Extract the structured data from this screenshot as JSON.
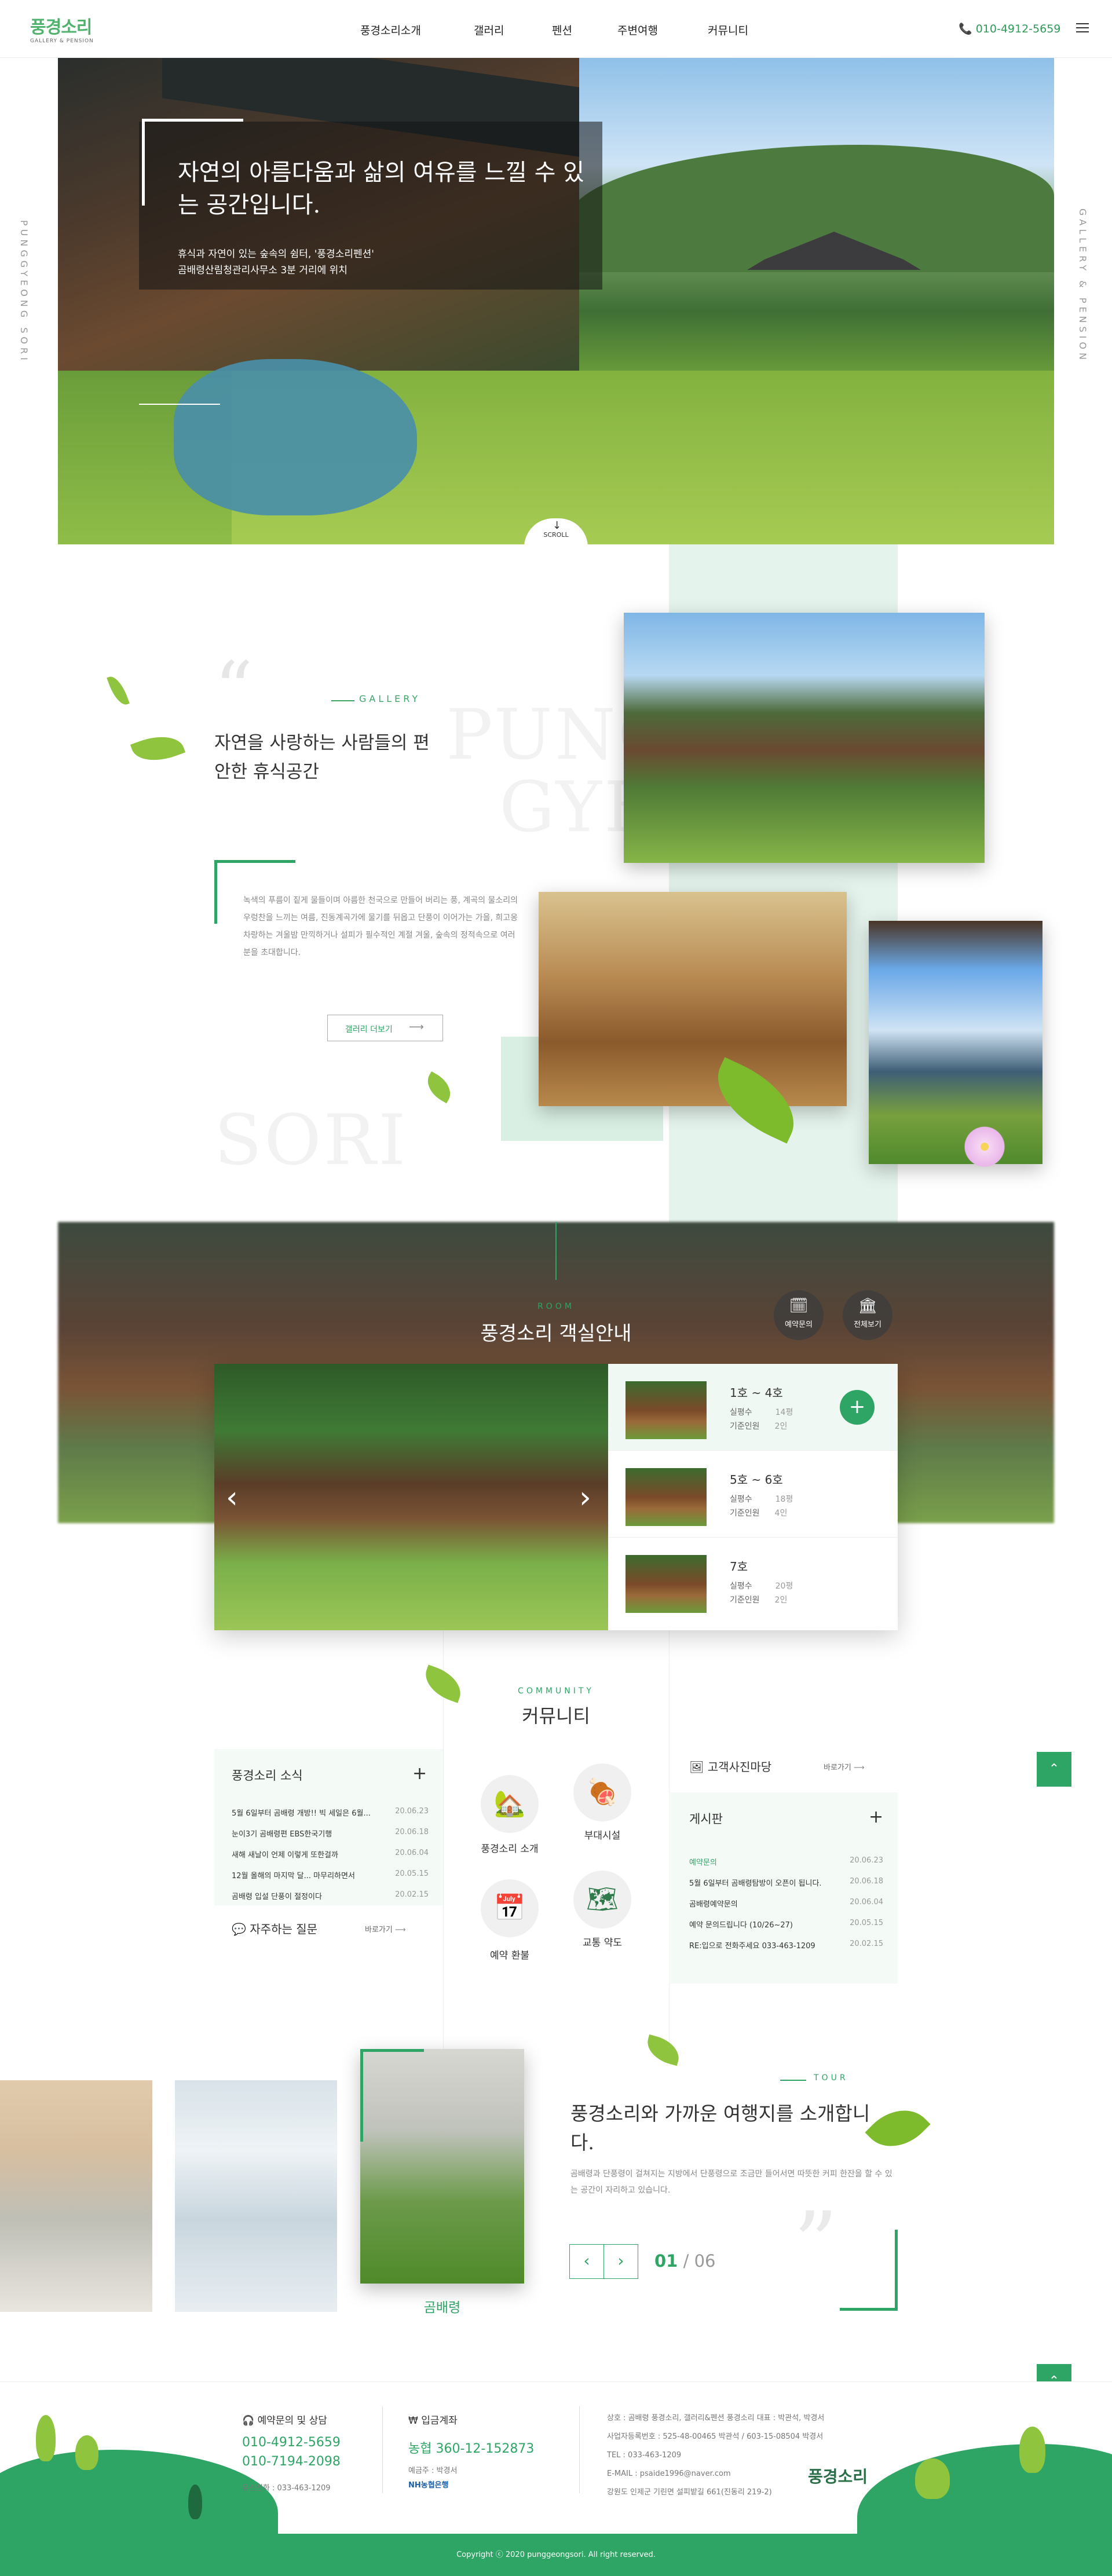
{
  "header": {
    "logo_kr": "풍경소리",
    "logo_en": "GALLERY & PENSION",
    "nav": [
      "풍경소리소개",
      "갤러리",
      "펜션",
      "주변여행",
      "커뮤니티"
    ],
    "phone": "010-4912-5659"
  },
  "hero": {
    "title": "자연의 아름다움과 삶의 여유를 느낄 수 있는 공간입니다.",
    "subtitle_1": "휴식과 자연이 있는 숲속의 쉼터, '풍경소리펜션'",
    "subtitle_2": "곰배령산림청관리사무소 3분 거리에 위치",
    "side_left": "PUNGGYEONG SORI",
    "side_right": "GALLERY & PENSION",
    "scroll": "SCROLL"
  },
  "gallery": {
    "eyebrow": "GALLERY",
    "title": "자연을 사랑하는 사람들의 편안한 휴식공간",
    "ghost_1": "PUNG",
    "ghost_2": "GYEONG",
    "ghost_3": "SORI",
    "desc": "녹색의 푸름이 짙게 물들이며 아름한 천국으로 만들어 버리는 풍, 계곡의 물소리의 우렁찬을 느끼는 여름, 진동계곡가에 물기를 뒤옵고 단풍이 이어가는 가을, 희고옹 차랑하는 겨울밤 만끽하거나 설피가 필수적인 계절 겨울, 숲속의 정적속으로 여러분을 초대합니다.",
    "more": "갤러리 더보기"
  },
  "room": {
    "eyebrow": "ROOM",
    "title": "풍경소리 객실안내",
    "icon_reserve": "예약문의",
    "icon_all": "전체보기",
    "items": [
      {
        "name": "1호 ~ 4호",
        "area_label": "실평수",
        "area": "14평",
        "cap_label": "기준인원",
        "cap": "2인"
      },
      {
        "name": "5호 ~ 6호",
        "area_label": "실평수",
        "area": "18평",
        "cap_label": "기준인원",
        "cap": "4인"
      },
      {
        "name": "7호",
        "area_label": "실평수",
        "area": "20평",
        "cap_label": "기준인원",
        "cap": "2인"
      }
    ]
  },
  "community": {
    "eyebrow": "COMMUNITY",
    "title": "커뮤니티",
    "news_title": "풍경소리 소식",
    "news": [
      {
        "t": "5월 6일부터 곰배령 개방!! 빅 세일은 6월...",
        "d": "20.06.23"
      },
      {
        "t": "눈이3기 곰배령편 EBS한국기행",
        "d": "20.06.18"
      },
      {
        "t": "새해 새날이 언제 이렇게 또한걸까",
        "d": "20.06.04"
      },
      {
        "t": "12월 올해의 마지막 달... 마무리하면서",
        "d": "20.05.15"
      },
      {
        "t": "곰배령 입설 단풍이 절정이다",
        "d": "20.02.15"
      }
    ],
    "faq": "자주하는 질문",
    "faq_more": "바로가기",
    "icons": [
      {
        "name": "풍경소리 소개",
        "icon": "🏡"
      },
      {
        "name": "부대시설",
        "icon": "🍖"
      },
      {
        "name": "예약 환불",
        "icon": "📅"
      },
      {
        "name": "교통 약도",
        "icon": "🗺"
      }
    ],
    "photo_title": "고객사진마당",
    "photo_more": "바로가기",
    "board_title": "게시판",
    "board": [
      {
        "t": "예약문의",
        "d": "20.06.23",
        "hl": true
      },
      {
        "t": "5월 6일부터 곰배령탐방이 오픈이 됩니다.",
        "d": "20.06.18",
        "hl": false
      },
      {
        "t": "곰배령예약문의",
        "d": "20.06.04",
        "hl": false
      },
      {
        "t": "예약 문의드립니다 (10/26~27)",
        "d": "20.05.15",
        "hl": false
      },
      {
        "t": "RE:입으로 전화주세요 033-463-1209",
        "d": "20.02.15",
        "hl": false
      }
    ]
  },
  "tour": {
    "eyebrow": "TOUR",
    "title": "풍경소리와 가까운 여행지를 소개합니다.",
    "desc": "곰배령과 단풍령이 걸쳐지는 지방에서 단풍령으로 조금만 들어서면 따뜻한 커피 한잔을 할 수 있는 공간이 자리하고 있습니다.",
    "caption": "곰배령",
    "page_current": "01",
    "page_total": "/ 06",
    "prev": "‹",
    "next": "›"
  },
  "footer": {
    "reserve_title": "예약문의 및 상담",
    "phone1": "010-4912-5659",
    "phone2": "010-7194-2098",
    "tel": "유선전화 : 033-463-1209",
    "bank_title": "입금계좌",
    "bank_account": "농협 360-12-152873",
    "bank_holder": "예금주 : 박경서",
    "bank_name": "NH농협은행",
    "info": [
      "상호 : 곰배령 풍경소리, 갤러리&펜션 풍경소리    대표 : 박관석, 박경서",
      "사업자등록번호 : 525-48-00465 박관석  /  603-15-08504 박경서",
      "TEL : 033-463-1209",
      "E-MAIL : psaide1996@naver.com",
      "강원도 인제군 기린면 설피밭길 661(진동리 219-2)"
    ],
    "logo": "풍경소리",
    "copyright": "Copyright ⓒ 2020 punggeongsori. All right reserved."
  }
}
